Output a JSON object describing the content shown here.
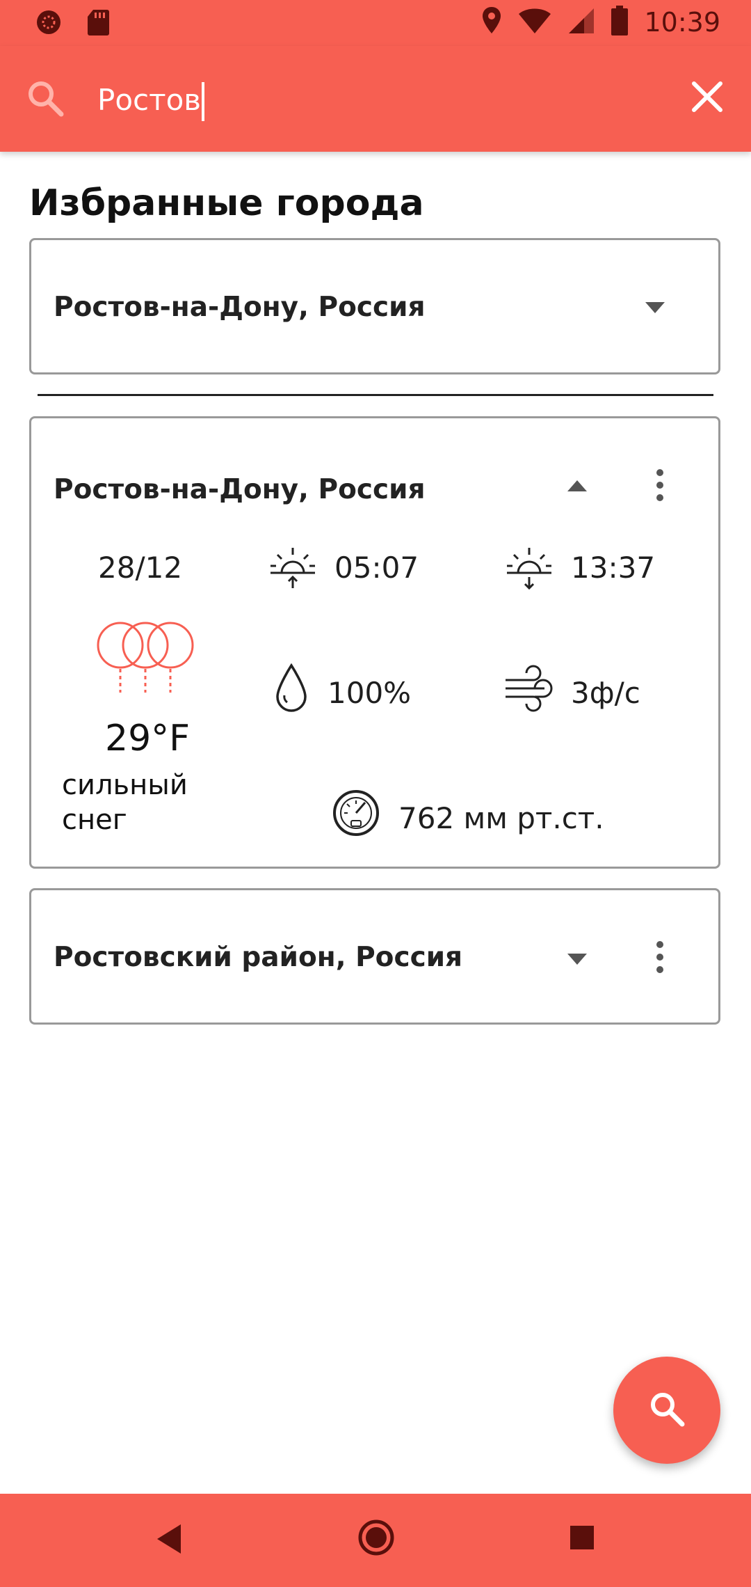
{
  "status_bar": {
    "time": "10:39",
    "icons": [
      "circle-notification-icon",
      "sd-card-icon",
      "location-icon",
      "wifi-icon",
      "signal-icon",
      "battery-icon"
    ]
  },
  "search": {
    "value": "Ростов",
    "icon": "search-icon",
    "clear_icon": "close-icon"
  },
  "section_title": "Избранные города",
  "cards": [
    {
      "city": "Ростов-на-Дону, Россия",
      "expanded": false,
      "toggle_icon": "chevron-down-icon"
    },
    {
      "city": "Ростов-на-Дону, Россия",
      "expanded": true,
      "toggle_icon": "chevron-up-icon",
      "menu_icon": "more-vert-icon",
      "weather": {
        "date": "28/12",
        "sunrise": "05:07",
        "sunset": "13:37",
        "humidity": "100%",
        "wind": "3ф/с",
        "temperature": "29°F",
        "condition_line1": "сильный",
        "condition_line2": "снег",
        "pressure": "762 мм рт.ст.",
        "condition_icon": "heavy-snow-cloud-icon"
      }
    },
    {
      "city": "Ростовский район, Россия",
      "expanded": false,
      "toggle_icon": "chevron-down-icon",
      "menu_icon": "more-vert-icon"
    }
  ],
  "fab": {
    "icon": "search-icon"
  },
  "nav": {
    "back": "back-icon",
    "home": "home-icon",
    "recents": "recents-icon"
  },
  "colors": {
    "accent": "#f75f52",
    "status_icons": "#5a0f0b",
    "weather_icon": "#f75f52"
  }
}
